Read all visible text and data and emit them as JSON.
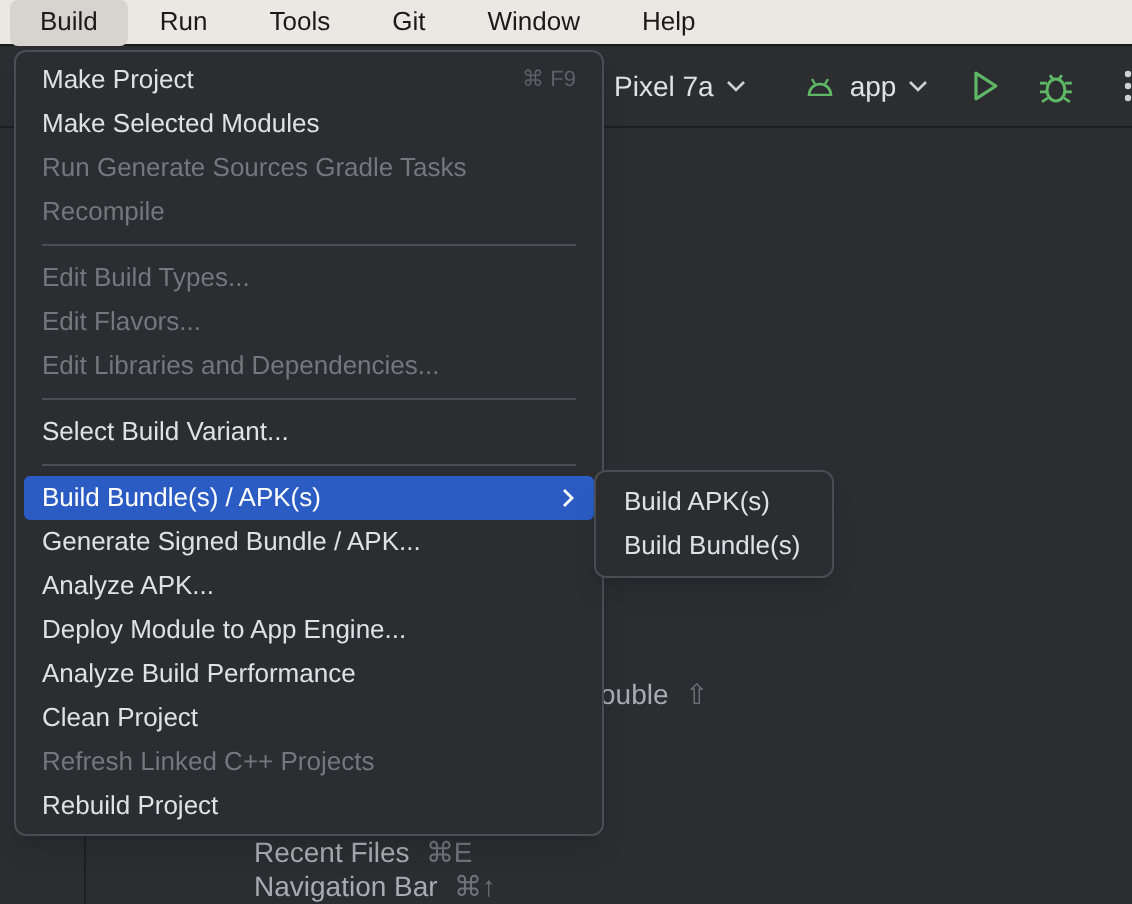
{
  "menu_bar": [
    {
      "label": "Build",
      "selected": true
    },
    {
      "label": "Run",
      "selected": false
    },
    {
      "label": "Tools",
      "selected": false
    },
    {
      "label": "Git",
      "selected": false
    },
    {
      "label": "Window",
      "selected": false
    },
    {
      "label": "Help",
      "selected": false
    }
  ],
  "toolbar": {
    "device": "Pixel 7a",
    "run_config": "app"
  },
  "editor_hints": [
    {
      "label": "ouble",
      "shortcut": "⇧"
    },
    {
      "label": "Recent Files",
      "shortcut": "⌘E"
    },
    {
      "label": "Navigation Bar",
      "shortcut": "⌘↑"
    }
  ],
  "build_menu": [
    {
      "kind": "item",
      "label": "Make Project",
      "shortcut": "⌘ F9",
      "disabled": false,
      "selected": false,
      "submenu": false
    },
    {
      "kind": "item",
      "label": "Make Selected Modules",
      "disabled": false,
      "selected": false,
      "submenu": false
    },
    {
      "kind": "item",
      "label": "Run Generate Sources Gradle Tasks",
      "disabled": true,
      "selected": false,
      "submenu": false
    },
    {
      "kind": "item",
      "label": "Recompile",
      "disabled": true,
      "selected": false,
      "submenu": false
    },
    {
      "kind": "separator"
    },
    {
      "kind": "item",
      "label": "Edit Build Types...",
      "disabled": true,
      "selected": false,
      "submenu": false
    },
    {
      "kind": "item",
      "label": "Edit Flavors...",
      "disabled": true,
      "selected": false,
      "submenu": false
    },
    {
      "kind": "item",
      "label": "Edit Libraries and Dependencies...",
      "disabled": true,
      "selected": false,
      "submenu": false
    },
    {
      "kind": "separator"
    },
    {
      "kind": "item",
      "label": "Select Build Variant...",
      "disabled": false,
      "selected": false,
      "submenu": false
    },
    {
      "kind": "separator"
    },
    {
      "kind": "item",
      "label": "Build Bundle(s) / APK(s)",
      "disabled": false,
      "selected": true,
      "submenu": true
    },
    {
      "kind": "item",
      "label": "Generate Signed Bundle / APK...",
      "disabled": false,
      "selected": false,
      "submenu": false
    },
    {
      "kind": "item",
      "label": "Analyze APK...",
      "disabled": false,
      "selected": false,
      "submenu": false
    },
    {
      "kind": "item",
      "label": "Deploy Module to App Engine...",
      "disabled": false,
      "selected": false,
      "submenu": false
    },
    {
      "kind": "item",
      "label": "Analyze Build Performance",
      "disabled": false,
      "selected": false,
      "submenu": false
    },
    {
      "kind": "item",
      "label": "Clean Project",
      "disabled": false,
      "selected": false,
      "submenu": false
    },
    {
      "kind": "item",
      "label": "Refresh Linked C++ Projects",
      "disabled": true,
      "selected": false,
      "submenu": false
    },
    {
      "kind": "item",
      "label": "Rebuild Project",
      "disabled": false,
      "selected": false,
      "submenu": false
    }
  ],
  "submenu": [
    {
      "label": "Build APK(s)",
      "selected": false
    },
    {
      "label": "Build Bundle(s)",
      "selected": false
    }
  ]
}
